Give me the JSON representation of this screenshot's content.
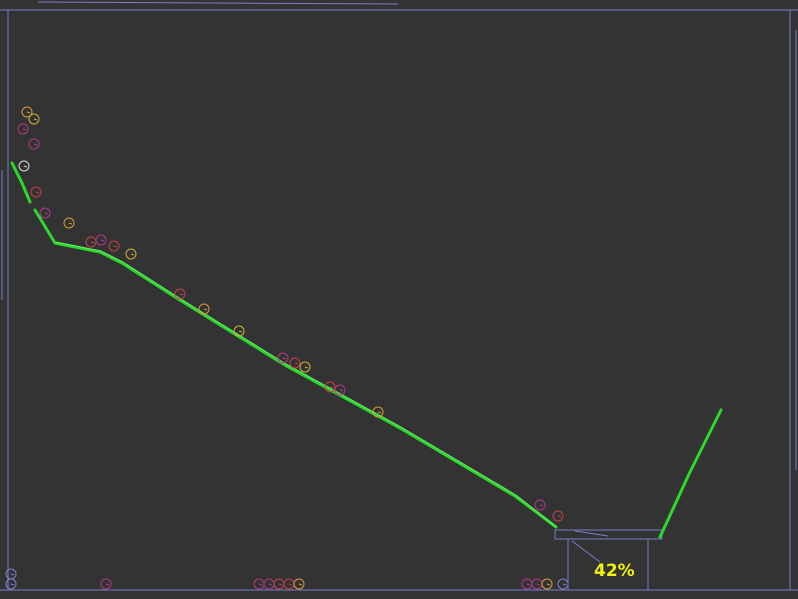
{
  "game": {
    "progress_label": "42%",
    "progress": 0.42
  },
  "colors": {
    "background": "#333333",
    "boundary": "#7a7fc8",
    "track": "#2bd92b",
    "track_highlight": "#7df07d",
    "progress_text": "#f2f20a",
    "ball_orange": "#d89a3a",
    "ball_yellow": "#c8b43a",
    "ball_magenta": "#b0388a",
    "ball_red": "#c8404a",
    "ball_white": "#d8d8d8",
    "ball_blue": "#7a7fc8"
  },
  "icons": {
    "ball": "circle-outline-icon",
    "funnel": "collection-bin-icon"
  }
}
